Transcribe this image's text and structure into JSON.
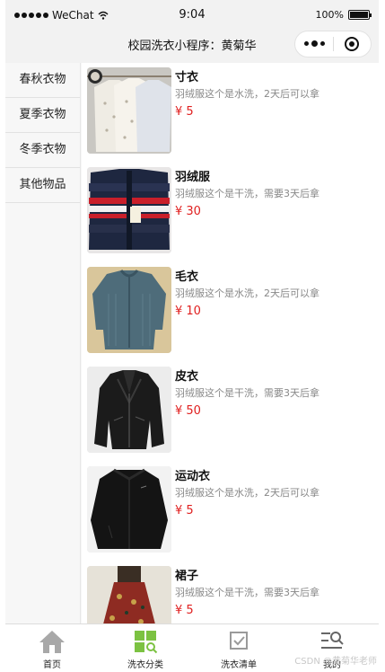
{
  "status_bar": {
    "carrier": "WeChat",
    "time": "9:04",
    "battery": "100%"
  },
  "nav": {
    "title": "校园洗衣小程序：黄菊华"
  },
  "sidebar": {
    "items": [
      {
        "label": "春秋衣物"
      },
      {
        "label": "夏季衣物"
      },
      {
        "label": "冬季衣物"
      },
      {
        "label": "其他物品"
      }
    ]
  },
  "products": [
    {
      "name": "寸衣",
      "desc": "羽绒服这个是水洗，2天后可以拿",
      "price": "¥ 5",
      "image": "white-shirts-on-hangers"
    },
    {
      "name": "羽绒服",
      "desc": "羽绒服这个是干洗，需要3天后拿",
      "price": "¥ 30",
      "image": "navy-striped-down-jacket"
    },
    {
      "name": "毛衣",
      "desc": "羽绒服这个是水洗，2天后可以拿",
      "price": "¥ 10",
      "image": "teal-knit-sweater"
    },
    {
      "name": "皮衣",
      "desc": "羽绒服这个是干洗，需要3天后拿",
      "price": "¥ 50",
      "image": "black-leather-jacket"
    },
    {
      "name": "运动衣",
      "desc": "羽绒服这个是水洗，2天后可以拿",
      "price": "¥ 5",
      "image": "black-sports-jacket"
    },
    {
      "name": "裙子",
      "desc": "羽绒服这个是干洗，需要3天后拿",
      "price": "¥ 5",
      "image": "red-floral-skirt"
    }
  ],
  "tab_bar": {
    "tabs": [
      {
        "label": "首页",
        "icon": "home-icon"
      },
      {
        "label": "洗衣分类",
        "icon": "category-icon",
        "color": "#7cc242"
      },
      {
        "label": "洗衣清单",
        "icon": "checklist-icon"
      },
      {
        "label": "我的",
        "icon": "profile-search-icon"
      }
    ]
  },
  "watermark": "CSDN @黄菊华老师",
  "colors": {
    "price": "#e02020",
    "active_tab": "#7cc242"
  }
}
